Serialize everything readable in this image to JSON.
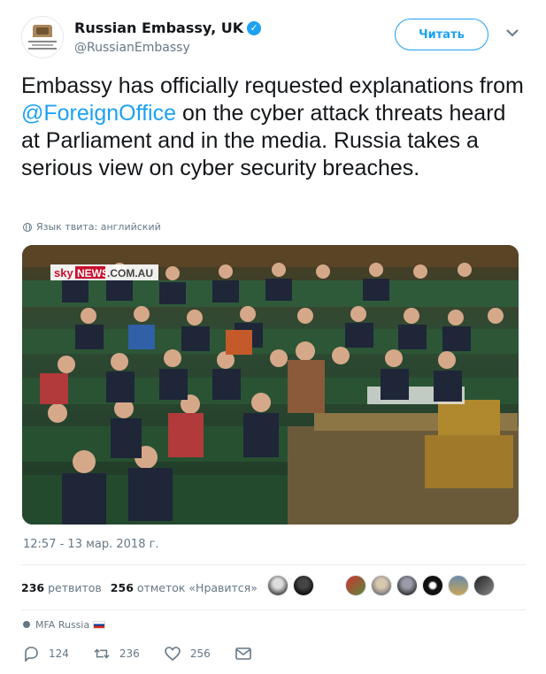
{
  "header": {
    "name": "Russian Embassy, UK",
    "handle": "@RussianEmbassy",
    "follow_label": "Читать"
  },
  "tweet": {
    "text_before": "Embassy has officially requested explanations from ",
    "mention": "@ForeignOffice",
    "text_after": " on the cyber attack threats heard at Parliament and in the media. Russia takes a serious view on cyber security breaches.",
    "language_note": "Язык твита: английский",
    "media_watermark_sky": "sky",
    "media_watermark_news": "NEWS",
    "media_watermark_domain": ".COM.AU",
    "timestamp": "12:57 - 13 мар. 2018 г."
  },
  "stats": {
    "retweets_count": "236",
    "retweets_label": "ретвитов",
    "likes_count": "256",
    "likes_label": "отметок «Нравится»"
  },
  "source": {
    "label": "MFA Russia"
  },
  "actions": {
    "reply_count": "124",
    "retweet_count": "236",
    "like_count": "256"
  },
  "colors": {
    "accent": "#1da1f2",
    "text": "#14171a",
    "muted": "#657786"
  }
}
